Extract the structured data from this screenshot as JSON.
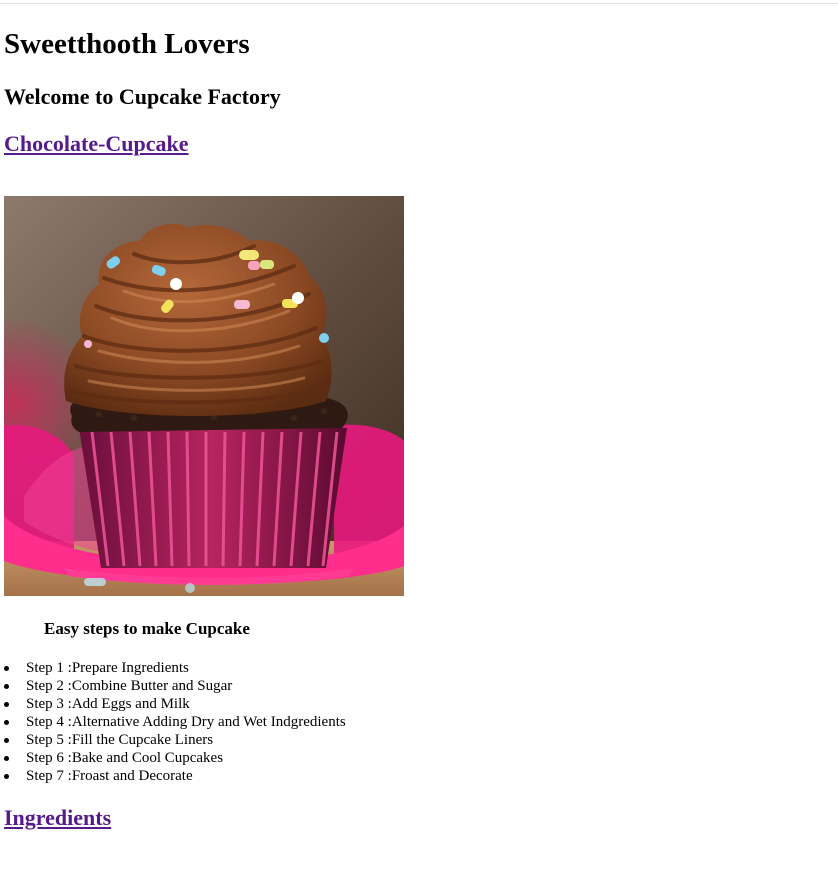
{
  "page": {
    "title": "Sweetthooth Lovers",
    "welcome": "Welcome to Cupcake Factory",
    "recipe_link": "Chocolate-Cupcake",
    "steps_heading": "Easy steps to make Cupcake",
    "steps": [
      "Step 1 :Prepare Ingredients",
      "Step 2 :Combine Butter and Sugar",
      "Step 3 :Add Eggs and Milk",
      "Step 4 :Alternative Adding Dry and Wet Indgredients",
      "Step 5 :Fill the Cupcake Liners",
      "Step 6 :Bake and Cool Cupcakes",
      "Step 7 :Froast and Decorate"
    ],
    "ingredients_link": "Ingredients"
  },
  "colors": {
    "link": "#551a8b",
    "frosting": "#8a4a26",
    "liner": "#e0218a"
  }
}
